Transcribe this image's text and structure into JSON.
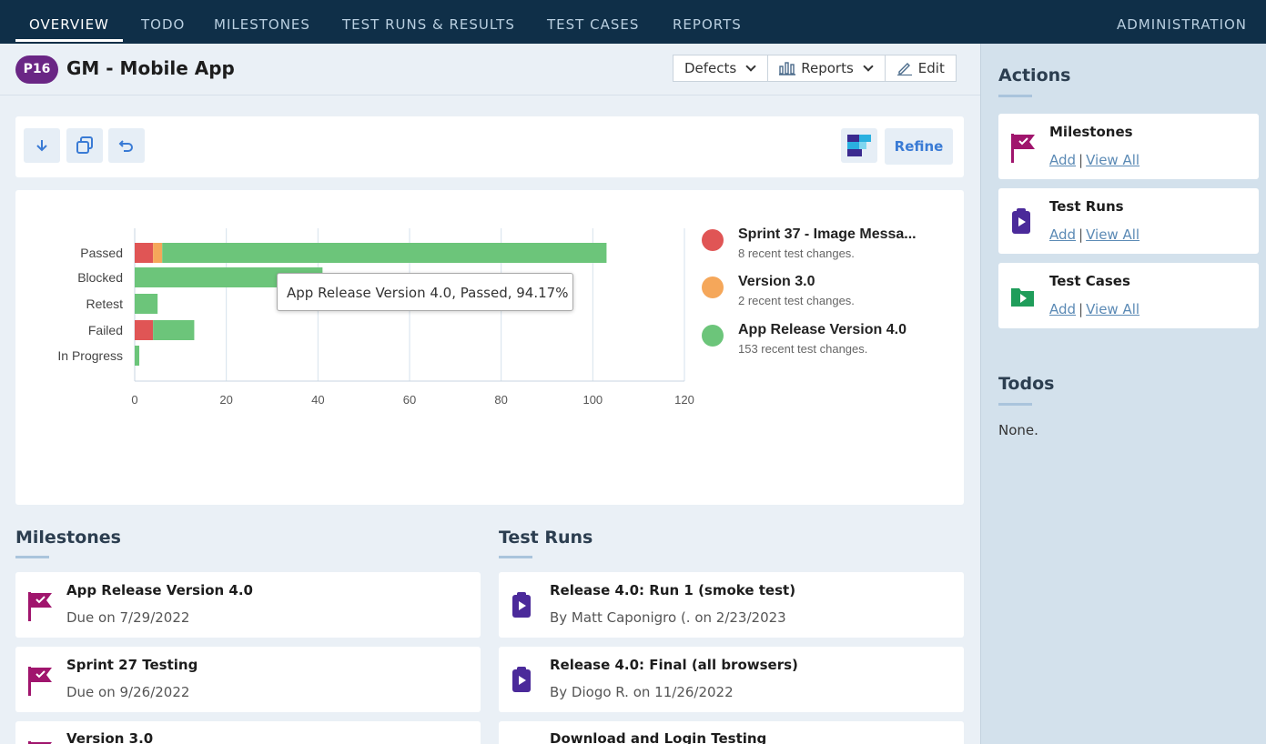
{
  "nav": {
    "tabs": [
      "OVERVIEW",
      "TODO",
      "MILESTONES",
      "TEST RUNS & RESULTS",
      "TEST CASES",
      "REPORTS"
    ],
    "admin": "ADMINISTRATION"
  },
  "project": {
    "badge": "P16",
    "title": "GM - Mobile App"
  },
  "header_buttons": {
    "defects": "Defects",
    "reports": "Reports",
    "edit": "Edit"
  },
  "toolbar": {
    "refine": "Refine"
  },
  "tooltip": "App Release Version 4.0, Passed, 94.17%",
  "legend": [
    {
      "name": "Sprint 37 - Image Messa...",
      "sub": "8 recent test changes.",
      "color": "#e05555"
    },
    {
      "name": "Version 3.0",
      "sub": "2 recent test changes.",
      "color": "#f5a75a"
    },
    {
      "name": "App Release Version 4.0",
      "sub": "153 recent test changes.",
      "color": "#6cc57a"
    }
  ],
  "chart_data": {
    "type": "bar",
    "orientation": "horizontal",
    "stacked": true,
    "categories": [
      "Passed",
      "Blocked",
      "Retest",
      "Failed",
      "In Progress"
    ],
    "series": [
      {
        "name": "Sprint 37 - Image Messa...",
        "color": "#e05555",
        "values": [
          4,
          0,
          0,
          4,
          0
        ]
      },
      {
        "name": "Version 3.0",
        "color": "#f5a75a",
        "values": [
          2,
          0,
          0,
          0,
          0
        ]
      },
      {
        "name": "App Release Version 4.0",
        "color": "#6cc57a",
        "values": [
          97,
          41,
          5,
          9,
          1
        ]
      }
    ],
    "xlim": [
      0,
      120
    ],
    "xticks": [
      0,
      20,
      40,
      60,
      80,
      100,
      120
    ],
    "grid": true,
    "legend_position": "right"
  },
  "sidebar": {
    "actions_title": "Actions",
    "actions": [
      {
        "title": "Milestones",
        "add": "Add",
        "sep": "|",
        "view": "View All"
      },
      {
        "title": "Test Runs",
        "add": "Add",
        "sep": "|",
        "view": "View All"
      },
      {
        "title": "Test Cases",
        "add": "Add",
        "sep": "|",
        "view": "View All"
      }
    ],
    "todos_title": "Todos",
    "todos_none": "None."
  },
  "milestones": {
    "title": "Milestones",
    "items": [
      {
        "name": "App Release Version 4.0",
        "sub": "Due on 7/29/2022"
      },
      {
        "name": "Sprint 27 Testing",
        "sub": "Due on 9/26/2022"
      },
      {
        "name": "Version 3.0",
        "sub": ""
      }
    ]
  },
  "testruns": {
    "title": "Test Runs",
    "items": [
      {
        "name": "Release 4.0: Run 1 (smoke test)",
        "sub": "By Matt Caponigro (. on 2/23/2023"
      },
      {
        "name": "Release 4.0: Final (all browsers)",
        "sub": "By Diogo R. on 11/26/2022"
      },
      {
        "name": "Download and Login Testing",
        "sub": ""
      }
    ]
  },
  "colors": {
    "nav_bg": "#0f2f48",
    "badge": "#6a2685",
    "accent": "#3a7bd5",
    "milestone_icon": "#a0156d",
    "testrun_icon": "#4b2a9a",
    "testcase_icon": "#1f9d5a"
  }
}
